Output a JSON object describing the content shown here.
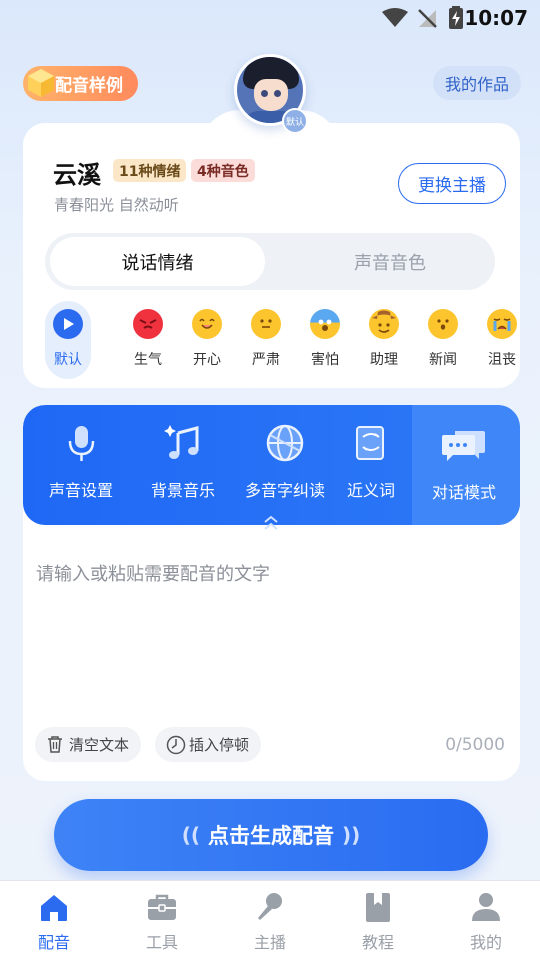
{
  "status_bar": {
    "time": "10:07"
  },
  "header": {
    "sample_label": "配音样例",
    "my_works_label": "我的作品",
    "avatar_badge": "默认"
  },
  "voice": {
    "name": "云溪",
    "emotion_count_tag": "11种情绪",
    "timbre_count_tag": "4种音色",
    "description": "青春阳光 自然动听",
    "change_label": "更换主播",
    "tabs": [
      "说话情绪",
      "声音音色"
    ],
    "emotions": [
      {
        "label": "默认",
        "icon": "play-icon",
        "color": "#2b6bf0"
      },
      {
        "label": "生气",
        "icon": "angry-face-icon",
        "color": "#f0323e"
      },
      {
        "label": "开心",
        "icon": "happy-face-icon",
        "color": "#fcc52d"
      },
      {
        "label": "严肃",
        "icon": "neutral-face-icon",
        "color": "#fcc52d"
      },
      {
        "label": "害怕",
        "icon": "scared-face-icon",
        "color": "#fcc52d"
      },
      {
        "label": "助理",
        "icon": "cowboy-face-icon",
        "color": "#fcc52d"
      },
      {
        "label": "新闻",
        "icon": "surprised-face-icon",
        "color": "#fcc52d"
      },
      {
        "label": "沮丧",
        "icon": "crying-face-icon",
        "color": "#fcc52d"
      }
    ]
  },
  "tools": {
    "items": [
      {
        "label": "声音设置",
        "icon": "microphone-icon"
      },
      {
        "label": "背景音乐",
        "icon": "music-note-icon"
      },
      {
        "label": "多音字纠读",
        "icon": "globe-icon"
      },
      {
        "label": "近义词",
        "icon": "document-icon"
      },
      {
        "label": "对话模式",
        "icon": "chat-bubbles-icon"
      }
    ]
  },
  "editor": {
    "placeholder": "请输入或粘贴需要配音的文字",
    "clear_label": "清空文本",
    "pause_label": "插入停顿",
    "counter": "0/5000"
  },
  "generate": {
    "label": "点击生成配音"
  },
  "nav": {
    "items": [
      {
        "label": "配音",
        "icon": "home-icon",
        "active": true
      },
      {
        "label": "工具",
        "icon": "toolbox-icon",
        "active": false
      },
      {
        "label": "主播",
        "icon": "microphone-icon",
        "active": false
      },
      {
        "label": "教程",
        "icon": "bookmark-book-icon",
        "active": false
      },
      {
        "label": "我的",
        "icon": "person-icon",
        "active": false
      }
    ]
  },
  "colors": {
    "accent": "#2b6bf0",
    "orange_badge": "#ff9a60",
    "tool_bar": "#1f68f5"
  }
}
